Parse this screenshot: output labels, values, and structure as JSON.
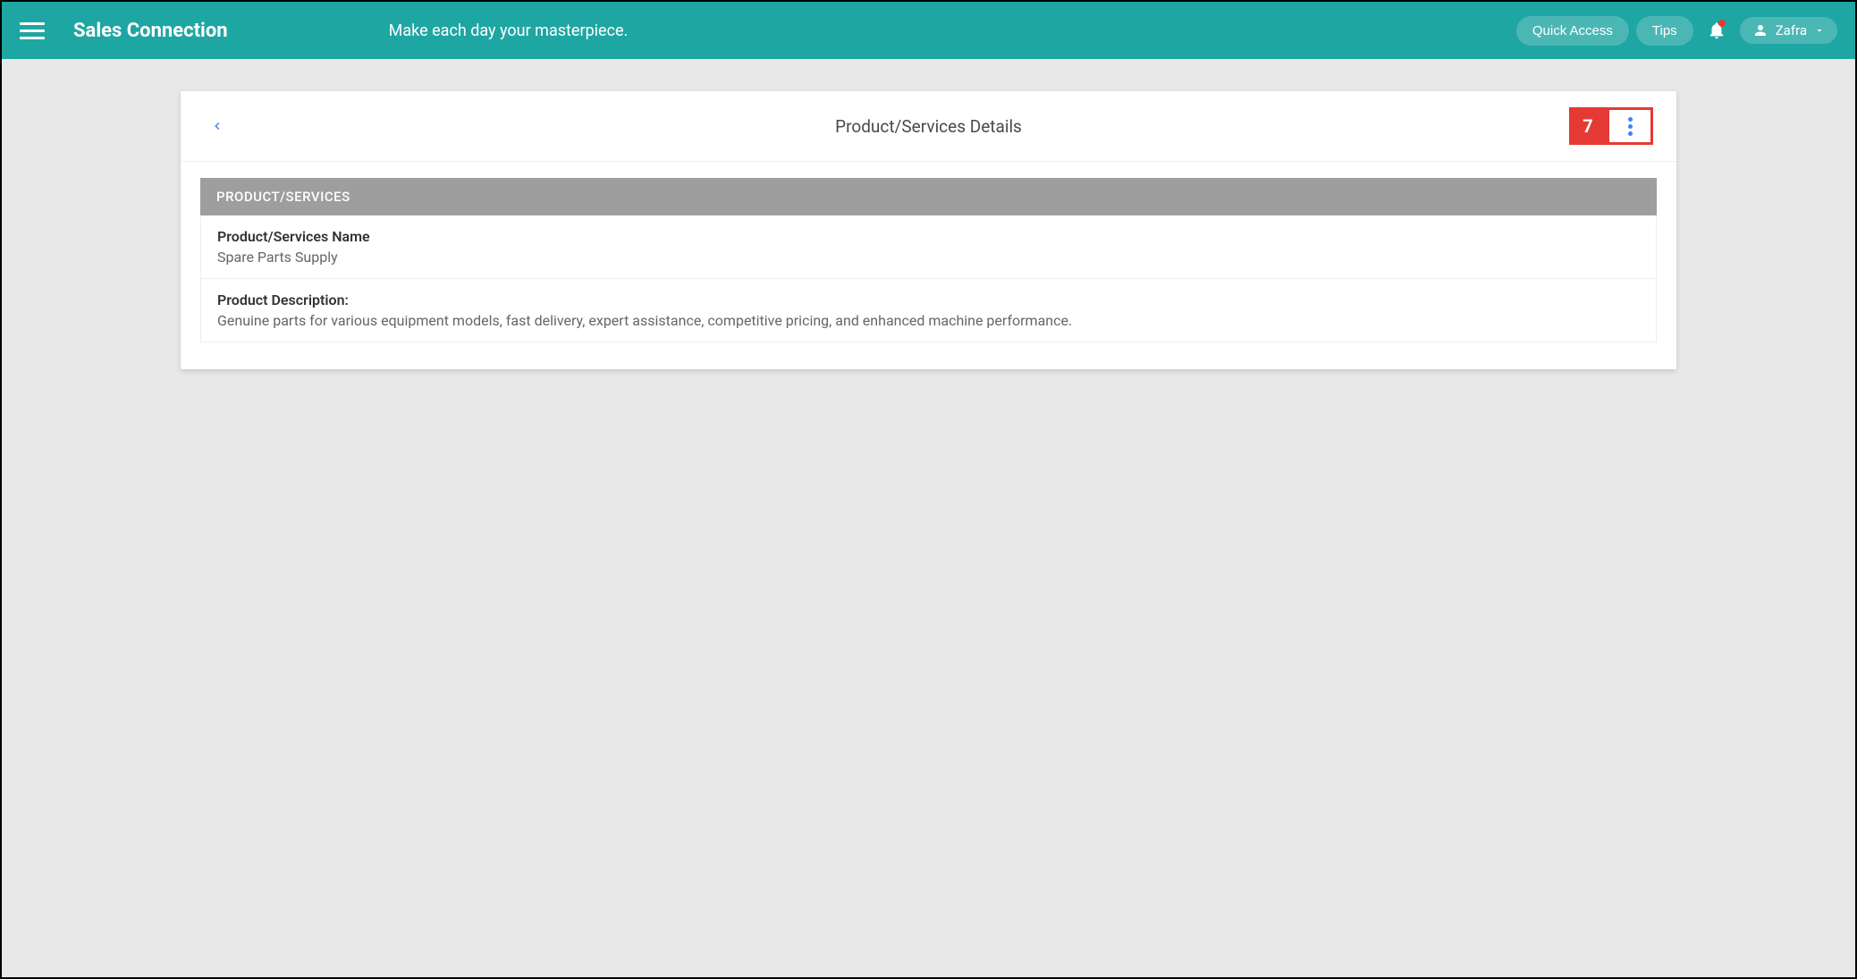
{
  "header": {
    "app_title": "Sales Connection",
    "tagline": "Make each day your masterpiece.",
    "quick_access_label": "Quick Access",
    "tips_label": "Tips",
    "user_name": "Zafra"
  },
  "card": {
    "title": "Product/Services Details",
    "annotation_number": "7",
    "section_header": "PRODUCT/SERVICES",
    "fields": [
      {
        "label": "Product/Services Name",
        "value": "Spare Parts Supply"
      },
      {
        "label": "Product Description:",
        "value": "Genuine parts for various equipment models, fast delivery, expert assistance, competitive pricing, and enhanced machine performance."
      }
    ]
  }
}
